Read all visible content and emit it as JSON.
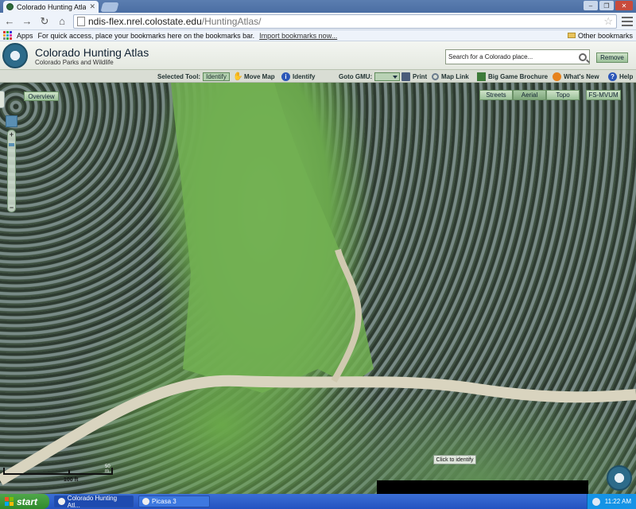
{
  "browser": {
    "tab_title": "Colorado Hunting Atlas",
    "url_host": "ndis-flex.nrel.colostate.edu",
    "url_path": "/HuntingAtlas/",
    "bookmarks_apps": "Apps",
    "bookmarks_hint": "For quick access, place your bookmarks here on the bookmarks bar.",
    "import_link": "Import bookmarks now...",
    "other_bookmarks": "Other bookmarks"
  },
  "app": {
    "title": "Colorado Hunting Atlas",
    "subtitle": "Colorado Parks and Wildlife",
    "search_placeholder": "Search for a Colorado place...",
    "remove_label": "Remove"
  },
  "tools": {
    "selected_tool_label": "Selected Tool:",
    "selected_tool_value": "Identify",
    "move_map": "Move Map",
    "identify": "Identify",
    "goto_gmu": "Goto GMU:",
    "print": "Print",
    "map_link": "Map Link",
    "big_game_brochure": "Big Game Brochure",
    "whats_new": "What's New",
    "help": "Help"
  },
  "map": {
    "overview": "Overview",
    "basemaps": [
      "Streets",
      "Aerial",
      "Topo"
    ],
    "active_basemap": "Aerial",
    "fs_mvum": "FS-MVUM",
    "click_to_identify": "Click to identify",
    "scale_m": "50 m",
    "scale_ft": "100 ft"
  },
  "taskbar": {
    "start": "start",
    "tasks": [
      "Colorado Hunting Atl...",
      "Picasa 3"
    ],
    "clock": "11:22 AM"
  }
}
